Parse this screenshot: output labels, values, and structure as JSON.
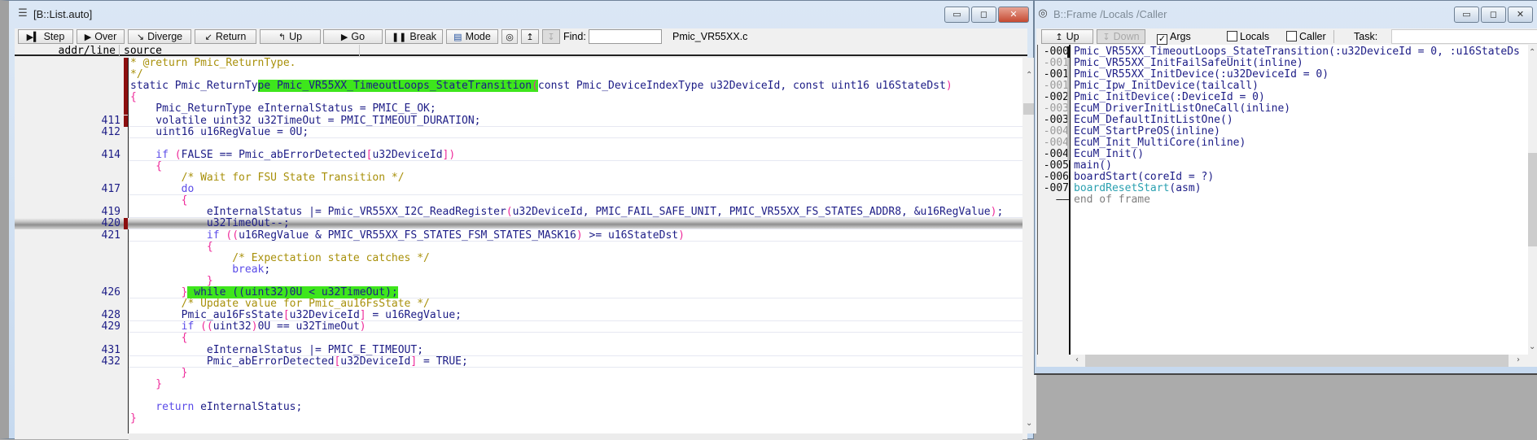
{
  "list_window": {
    "title": "[B::List.auto]",
    "window_buttons": {
      "minimize": "▭",
      "maximize": "◻",
      "close": "✕"
    },
    "toolbar": {
      "step": "Step",
      "over": "Over",
      "diverge": "Diverge",
      "return": "Return",
      "up": "Up",
      "go": "Go",
      "break": "Break",
      "mode": "Mode",
      "find_label": "Find:",
      "find_value": "",
      "file_name": "Pmic_VR55XX.c"
    },
    "columns": {
      "addr_line": "addr/line",
      "source": "source"
    },
    "lines": [
      {
        "n": "",
        "m": 1,
        "s": [
          [
            "* @return Pmic_ReturnType.",
            "c"
          ]
        ]
      },
      {
        "n": "",
        "m": 1,
        "s": [
          [
            "*/",
            "c"
          ]
        ]
      },
      {
        "n": "",
        "m": 1,
        "s": [
          [
            "static Pmic_ReturnTy",
            "t"
          ],
          [
            "pe Pmic_VR55XX_TimeoutLoops_StateTransition",
            "t h"
          ],
          [
            "(",
            "p h"
          ],
          [
            "const Pmic_DeviceIndexType u32DeviceId, const uint16 u16StateDst",
            "t"
          ],
          [
            ")",
            "p"
          ]
        ]
      },
      {
        "n": "",
        "m": 1,
        "s": [
          [
            "{",
            "p"
          ]
        ]
      },
      {
        "n": "",
        "m": 1,
        "s": [
          [
            "    Pmic_ReturnType eInternalStatus = PMIC_E_OK;",
            "t"
          ]
        ]
      },
      {
        "n": "411",
        "m": 1,
        "s": [
          [
            "    volatile uint32 u32TimeOut = PMIC_TIMEOUT_DURATION;",
            "t"
          ]
        ]
      },
      {
        "n": "412",
        "m": 0,
        "s": [
          [
            "    uint16 u16RegValue = 0U;",
            "t"
          ]
        ]
      },
      {
        "n": "",
        "m": 0,
        "s": []
      },
      {
        "n": "414",
        "m": 0,
        "s": [
          [
            "    if",
            "k"
          ],
          [
            " ",
            "t"
          ],
          [
            "(",
            "p"
          ],
          [
            "FALSE == Pmic_abErrorDetected",
            "t"
          ],
          [
            "[",
            "p"
          ],
          [
            "u32DeviceId",
            "t"
          ],
          [
            "]",
            "p"
          ],
          [
            ")",
            "p"
          ]
        ]
      },
      {
        "n": "",
        "m": 0,
        "s": [
          [
            "    {",
            "p"
          ]
        ]
      },
      {
        "n": "",
        "m": 0,
        "s": [
          [
            "        /* Wait for FSU State Transition */",
            "c"
          ]
        ]
      },
      {
        "n": "417",
        "m": 0,
        "s": [
          [
            "        do",
            "k"
          ]
        ]
      },
      {
        "n": "",
        "m": 0,
        "s": [
          [
            "        {",
            "p"
          ]
        ]
      },
      {
        "n": "419",
        "m": 0,
        "s": [
          [
            "            eInternalStatus |= Pmic_VR55XX_I2C_ReadRegister",
            "t"
          ],
          [
            "(",
            "p"
          ],
          [
            "u32DeviceId, PMIC_FAIL_SAFE_UNIT, PMIC_VR55XX_FS_STATES_ADDR8, &u16RegValue",
            "t"
          ],
          [
            ")",
            "p"
          ],
          [
            ";",
            "t"
          ]
        ]
      },
      {
        "n": "420",
        "m": 1,
        "cur": 1,
        "s": [
          [
            "            u32TimeOut--;",
            "t"
          ]
        ]
      },
      {
        "n": "421",
        "m": 0,
        "s": [
          [
            "            if",
            "k"
          ],
          [
            " ",
            "t"
          ],
          [
            "((",
            "p"
          ],
          [
            "u16RegValue & PMIC_VR55XX_FS_STATES_FSM_STATES_MASK16",
            "t"
          ],
          [
            ")",
            "p"
          ],
          [
            " >= u16StateDst",
            "t"
          ],
          [
            ")",
            "p"
          ]
        ]
      },
      {
        "n": "",
        "m": 0,
        "s": [
          [
            "            {",
            "p"
          ]
        ]
      },
      {
        "n": "",
        "m": 0,
        "s": [
          [
            "                /* Expectation state catches */",
            "c"
          ]
        ]
      },
      {
        "n": "",
        "m": 0,
        "s": [
          [
            "                break",
            "k"
          ],
          [
            ";",
            "t"
          ]
        ]
      },
      {
        "n": "",
        "m": 0,
        "s": [
          [
            "            }",
            "p"
          ]
        ]
      },
      {
        "n": "426",
        "m": 0,
        "s": [
          [
            "        }",
            "p"
          ],
          [
            " while ((uint32)0U < u32TimeOut);",
            "t h"
          ]
        ]
      },
      {
        "n": "",
        "m": 0,
        "s": [
          [
            "        /* Update value for Pmic_au16FsState */",
            "c"
          ]
        ]
      },
      {
        "n": "428",
        "m": 0,
        "s": [
          [
            "        Pmic_au16FsState",
            "t"
          ],
          [
            "[",
            "p"
          ],
          [
            "u32DeviceId",
            "t"
          ],
          [
            "]",
            "p"
          ],
          [
            " = u16RegValue;",
            "t"
          ]
        ]
      },
      {
        "n": "429",
        "m": 0,
        "s": [
          [
            "        if",
            "k"
          ],
          [
            " ",
            "t"
          ],
          [
            "((",
            "p"
          ],
          [
            "uint32",
            "t"
          ],
          [
            ")",
            "p"
          ],
          [
            "0U == u32TimeOut",
            "t"
          ],
          [
            ")",
            "p"
          ]
        ]
      },
      {
        "n": "",
        "m": 0,
        "s": [
          [
            "        {",
            "p"
          ]
        ]
      },
      {
        "n": "431",
        "m": 0,
        "s": [
          [
            "            eInternalStatus |= PMIC_E_TIMEOUT;",
            "t"
          ]
        ]
      },
      {
        "n": "432",
        "m": 0,
        "s": [
          [
            "            Pmic_abErrorDetected",
            "t"
          ],
          [
            "[",
            "p"
          ],
          [
            "u32DeviceId",
            "t"
          ],
          [
            "]",
            "p"
          ],
          [
            " = TRUE;",
            "t"
          ]
        ]
      },
      {
        "n": "",
        "m": 0,
        "s": [
          [
            "        }",
            "p"
          ]
        ]
      },
      {
        "n": "",
        "m": 0,
        "s": [
          [
            "    }",
            "p"
          ]
        ]
      },
      {
        "n": "",
        "m": 0,
        "s": []
      },
      {
        "n": "",
        "m": 0,
        "s": [
          [
            "    return",
            "k"
          ],
          [
            " eInternalStatus;",
            "t"
          ]
        ]
      },
      {
        "n": "",
        "m": 0,
        "s": [
          [
            "}",
            "p"
          ]
        ]
      }
    ]
  },
  "frame_window": {
    "title": "B::Frame /Locals /Caller",
    "window_buttons": {
      "minimize": "▭",
      "maximize": "◻",
      "close": "✕"
    },
    "toolbar": {
      "up": "Up",
      "down": "Down",
      "args": "Args",
      "args_checked": "✓",
      "locals": "Locals",
      "caller": "Caller",
      "task_label": "Task:",
      "task_value": ""
    },
    "frames": [
      {
        "n": "-000",
        "dim": 0,
        "s": [
          [
            "Pmic_VR55XX_TimeoutLoops_StateTransition(:u32DeviceId = 0, :u16StateDs",
            "t"
          ]
        ]
      },
      {
        "n": "-001",
        "dim": 1,
        "s": [
          [
            "Pmic_VR55XX_InitFailSafeUnit(inline)",
            "t"
          ]
        ]
      },
      {
        "n": "-001",
        "dim": 0,
        "s": [
          [
            "Pmic_VR55XX_InitDevice(:u32DeviceId = 0)",
            "t"
          ]
        ]
      },
      {
        "n": "-001",
        "dim": 1,
        "s": [
          [
            "Pmic_Ipw_InitDevice(tailcall)",
            "t"
          ]
        ]
      },
      {
        "n": "-002",
        "dim": 0,
        "s": [
          [
            "Pmic_InitDevice(:DeviceId = 0)",
            "t"
          ]
        ]
      },
      {
        "n": "-003",
        "dim": 1,
        "s": [
          [
            "EcuM_DriverInitListOneCall(inline)",
            "t"
          ]
        ]
      },
      {
        "n": "-003",
        "dim": 0,
        "s": [
          [
            "EcuM_DefaultInitListOne()",
            "t"
          ]
        ]
      },
      {
        "n": "-004",
        "dim": 1,
        "s": [
          [
            "EcuM_StartPreOS(inline)",
            "t"
          ]
        ]
      },
      {
        "n": "-004",
        "dim": 1,
        "s": [
          [
            "EcuM_Init_MultiCore(inline)",
            "t"
          ]
        ]
      },
      {
        "n": "-004",
        "dim": 0,
        "s": [
          [
            "EcuM_Init()",
            "t"
          ]
        ]
      },
      {
        "n": "-005",
        "dim": 0,
        "s": [
          [
            "main()",
            "t"
          ]
        ]
      },
      {
        "n": "-006",
        "dim": 0,
        "s": [
          [
            "boardStart(coreId = ?)",
            "t"
          ]
        ]
      },
      {
        "n": "-007",
        "dim": 0,
        "s": [
          [
            "boardResetStart",
            "teal"
          ],
          [
            "(asm)",
            "t"
          ]
        ]
      },
      {
        "n": "——",
        "dim": 0,
        "s": [
          [
            "end of frame",
            "gray"
          ]
        ]
      }
    ]
  },
  "colors": {
    "highlight": "#3ee61c",
    "current_line": "#8e8e8e",
    "marker": "#8b0e0e",
    "comment": "#a8900a",
    "keyword": "#5a4be8",
    "paren": "#ee2a9a",
    "text": "#1c1c86"
  }
}
